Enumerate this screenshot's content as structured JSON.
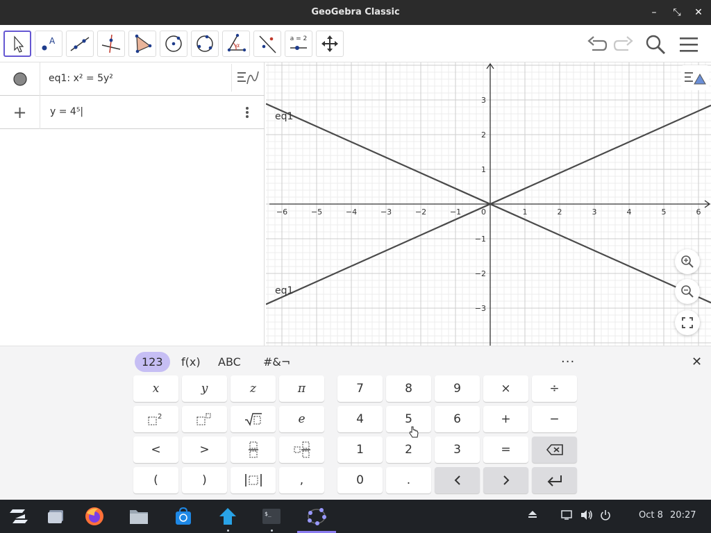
{
  "window": {
    "title": "GeoGebra Classic",
    "minimize": "–",
    "restore": "⤡",
    "close": "✕"
  },
  "toolbar": {
    "tools": [
      "move-tool",
      "point-tool",
      "line-tool",
      "perpendicular-tool",
      "polygon-tool",
      "circle-center-tool",
      "circle-three-points-tool",
      "angle-tool",
      "reflect-tool",
      "slider-tool",
      "move-graphics-tool"
    ],
    "slider_label": "a = 2"
  },
  "algebra": {
    "rows": [
      {
        "expr": "eq1: x² = 5y²"
      },
      {
        "add": "+",
        "expr": "y = 4⁵|"
      }
    ]
  },
  "graphics": {
    "labels": {
      "top": "eq1",
      "bottom": "eq1"
    },
    "x_ticks": [
      "−6",
      "−5",
      "−4",
      "−3",
      "−2",
      "−1",
      "0",
      "1",
      "2",
      "3",
      "4",
      "5",
      "6"
    ],
    "y_ticks": [
      "3",
      "2",
      "1",
      "−1",
      "−2",
      "−3"
    ]
  },
  "keyboard": {
    "tabs": [
      "123",
      "f(x)",
      "ABC",
      "#&¬"
    ],
    "more": "···",
    "close": "✕",
    "left_keys": [
      "x",
      "y",
      "z",
      "π",
      "□²",
      "□ⁿ",
      "√□",
      "e",
      "<",
      ">",
      "□/□",
      "□ᵢ",
      "|□|",
      ","
    ],
    "left_row4_parens": [
      "(",
      ")"
    ],
    "num_keys": [
      "7",
      "8",
      "9",
      "×",
      "÷",
      "4",
      "5",
      "6",
      "+",
      "−",
      "1",
      "2",
      "3",
      "=",
      "⌫",
      "0",
      ".",
      "‹",
      "›",
      "↵"
    ]
  },
  "taskbar": {
    "date": "Oct 8",
    "time": "20:27"
  },
  "colors": {
    "accent": "#6557d2",
    "tab_active": "#c6bef4",
    "line": "#4a4a4a",
    "titlebar": "#2b2b2b",
    "taskbar": "#1f2226"
  }
}
